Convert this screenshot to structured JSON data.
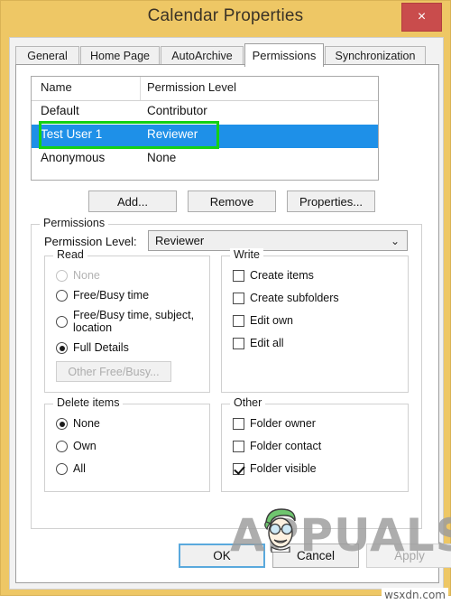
{
  "window": {
    "title": "Calendar Properties",
    "close_label": "×",
    "titlebar_color": "#eec765",
    "close_color": "#c94c4c"
  },
  "tabs": [
    {
      "label": "General",
      "active": false
    },
    {
      "label": "Home Page",
      "active": false
    },
    {
      "label": "AutoArchive",
      "active": false
    },
    {
      "label": "Permissions",
      "active": true
    },
    {
      "label": "Synchronization",
      "active": false
    }
  ],
  "permission_list": {
    "columns": [
      "Name",
      "Permission Level"
    ],
    "rows": [
      {
        "name": "Default",
        "level": "Contributor",
        "selected": false
      },
      {
        "name": "Test User 1",
        "level": "Reviewer",
        "selected": true
      },
      {
        "name": "Anonymous",
        "level": "None",
        "selected": false
      }
    ],
    "selection_color": "#1e90e8",
    "annotation_color": "#14d014"
  },
  "list_buttons": [
    {
      "label": "Add...",
      "enabled": true
    },
    {
      "label": "Remove",
      "enabled": true
    },
    {
      "label": "Properties...",
      "enabled": true
    }
  ],
  "permissions_group": {
    "title": "Permissions",
    "level_label": "Permission Level:",
    "level_value": "Reviewer",
    "dropdown_arrow": "⌄"
  },
  "read_group": {
    "title": "Read",
    "options": [
      {
        "label": "None",
        "selected": false,
        "enabled": false
      },
      {
        "label": "Free/Busy time",
        "selected": false,
        "enabled": true
      },
      {
        "label": "Free/Busy time, subject, location",
        "selected": false,
        "enabled": true
      },
      {
        "label": "Full Details",
        "selected": true,
        "enabled": true
      }
    ],
    "other_button": {
      "label": "Other Free/Busy...",
      "enabled": false
    }
  },
  "write_group": {
    "title": "Write",
    "options": [
      {
        "label": "Create items",
        "checked": false
      },
      {
        "label": "Create subfolders",
        "checked": false
      },
      {
        "label": "Edit own",
        "checked": false
      },
      {
        "label": "Edit all",
        "checked": false
      }
    ]
  },
  "delete_group": {
    "title": "Delete items",
    "options": [
      {
        "label": "None",
        "selected": true
      },
      {
        "label": "Own",
        "selected": false
      },
      {
        "label": "All",
        "selected": false
      }
    ]
  },
  "other_group": {
    "title": "Other",
    "options": [
      {
        "label": "Folder owner",
        "checked": false
      },
      {
        "label": "Folder contact",
        "checked": false
      },
      {
        "label": "Folder visible",
        "checked": true
      }
    ]
  },
  "footer_buttons": [
    {
      "label": "OK",
      "enabled": true,
      "focused": true
    },
    {
      "label": "Cancel",
      "enabled": true,
      "focused": false
    },
    {
      "label": "Apply",
      "enabled": false,
      "focused": false
    }
  ],
  "watermarks": {
    "brand": "APPUALS",
    "site": "wsxdn.com"
  }
}
